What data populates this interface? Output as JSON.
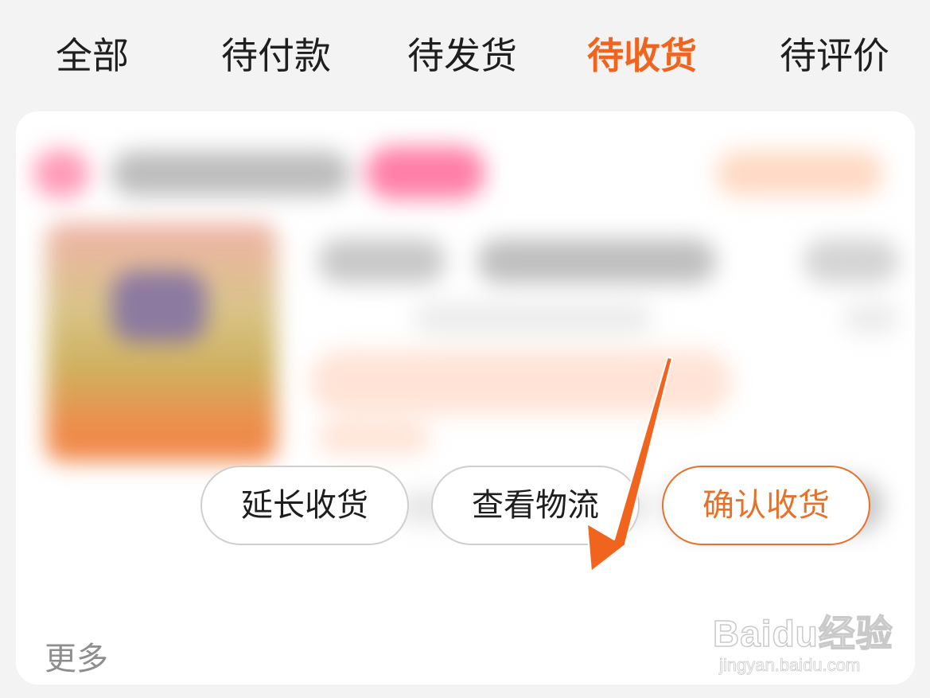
{
  "tabs": [
    {
      "label": "全部",
      "active": false
    },
    {
      "label": "待付款",
      "active": false
    },
    {
      "label": "待发货",
      "active": false
    },
    {
      "label": "待收货",
      "active": true
    },
    {
      "label": "待评价",
      "active": false
    }
  ],
  "colors": {
    "accent": "#f0641e",
    "confirm_border": "#e8712a",
    "arrow": "#f0641e",
    "background": "#f3f3f3",
    "card": "#ffffff"
  },
  "order_card": {
    "content_blurred": true,
    "more_label": "更多",
    "buttons": {
      "extend": "延长收货",
      "logistics": "查看物流",
      "confirm": "确认收货"
    }
  },
  "annotation": {
    "arrow_icon": "red-arrow-icon",
    "points_to": "查看物流"
  },
  "watermark": {
    "line1": "Baidu经验",
    "line2": "jingyan.baidu.com"
  }
}
